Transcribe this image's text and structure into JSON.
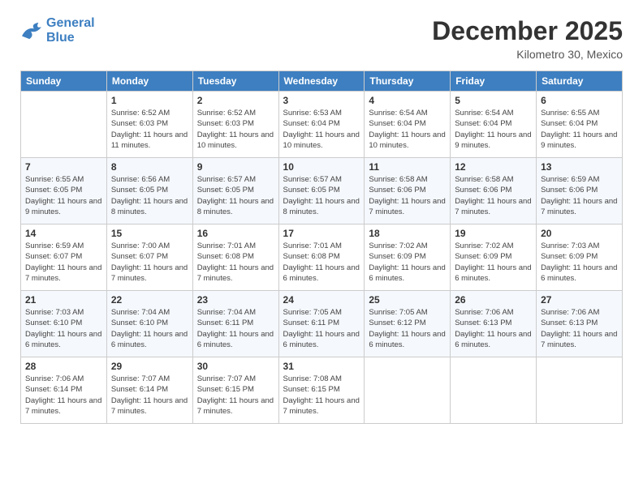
{
  "logo": {
    "line1": "General",
    "line2": "Blue"
  },
  "header": {
    "month": "December 2025",
    "location": "Kilometro 30, Mexico"
  },
  "weekdays": [
    "Sunday",
    "Monday",
    "Tuesday",
    "Wednesday",
    "Thursday",
    "Friday",
    "Saturday"
  ],
  "weeks": [
    [
      {
        "day": "",
        "sunrise": "",
        "sunset": "",
        "daylight": ""
      },
      {
        "day": "1",
        "sunrise": "Sunrise: 6:52 AM",
        "sunset": "Sunset: 6:03 PM",
        "daylight": "Daylight: 11 hours and 11 minutes."
      },
      {
        "day": "2",
        "sunrise": "Sunrise: 6:52 AM",
        "sunset": "Sunset: 6:03 PM",
        "daylight": "Daylight: 11 hours and 10 minutes."
      },
      {
        "day": "3",
        "sunrise": "Sunrise: 6:53 AM",
        "sunset": "Sunset: 6:04 PM",
        "daylight": "Daylight: 11 hours and 10 minutes."
      },
      {
        "day": "4",
        "sunrise": "Sunrise: 6:54 AM",
        "sunset": "Sunset: 6:04 PM",
        "daylight": "Daylight: 11 hours and 10 minutes."
      },
      {
        "day": "5",
        "sunrise": "Sunrise: 6:54 AM",
        "sunset": "Sunset: 6:04 PM",
        "daylight": "Daylight: 11 hours and 9 minutes."
      },
      {
        "day": "6",
        "sunrise": "Sunrise: 6:55 AM",
        "sunset": "Sunset: 6:04 PM",
        "daylight": "Daylight: 11 hours and 9 minutes."
      }
    ],
    [
      {
        "day": "7",
        "sunrise": "Sunrise: 6:55 AM",
        "sunset": "Sunset: 6:05 PM",
        "daylight": "Daylight: 11 hours and 9 minutes."
      },
      {
        "day": "8",
        "sunrise": "Sunrise: 6:56 AM",
        "sunset": "Sunset: 6:05 PM",
        "daylight": "Daylight: 11 hours and 8 minutes."
      },
      {
        "day": "9",
        "sunrise": "Sunrise: 6:57 AM",
        "sunset": "Sunset: 6:05 PM",
        "daylight": "Daylight: 11 hours and 8 minutes."
      },
      {
        "day": "10",
        "sunrise": "Sunrise: 6:57 AM",
        "sunset": "Sunset: 6:05 PM",
        "daylight": "Daylight: 11 hours and 8 minutes."
      },
      {
        "day": "11",
        "sunrise": "Sunrise: 6:58 AM",
        "sunset": "Sunset: 6:06 PM",
        "daylight": "Daylight: 11 hours and 7 minutes."
      },
      {
        "day": "12",
        "sunrise": "Sunrise: 6:58 AM",
        "sunset": "Sunset: 6:06 PM",
        "daylight": "Daylight: 11 hours and 7 minutes."
      },
      {
        "day": "13",
        "sunrise": "Sunrise: 6:59 AM",
        "sunset": "Sunset: 6:06 PM",
        "daylight": "Daylight: 11 hours and 7 minutes."
      }
    ],
    [
      {
        "day": "14",
        "sunrise": "Sunrise: 6:59 AM",
        "sunset": "Sunset: 6:07 PM",
        "daylight": "Daylight: 11 hours and 7 minutes."
      },
      {
        "day": "15",
        "sunrise": "Sunrise: 7:00 AM",
        "sunset": "Sunset: 6:07 PM",
        "daylight": "Daylight: 11 hours and 7 minutes."
      },
      {
        "day": "16",
        "sunrise": "Sunrise: 7:01 AM",
        "sunset": "Sunset: 6:08 PM",
        "daylight": "Daylight: 11 hours and 7 minutes."
      },
      {
        "day": "17",
        "sunrise": "Sunrise: 7:01 AM",
        "sunset": "Sunset: 6:08 PM",
        "daylight": "Daylight: 11 hours and 6 minutes."
      },
      {
        "day": "18",
        "sunrise": "Sunrise: 7:02 AM",
        "sunset": "Sunset: 6:09 PM",
        "daylight": "Daylight: 11 hours and 6 minutes."
      },
      {
        "day": "19",
        "sunrise": "Sunrise: 7:02 AM",
        "sunset": "Sunset: 6:09 PM",
        "daylight": "Daylight: 11 hours and 6 minutes."
      },
      {
        "day": "20",
        "sunrise": "Sunrise: 7:03 AM",
        "sunset": "Sunset: 6:09 PM",
        "daylight": "Daylight: 11 hours and 6 minutes."
      }
    ],
    [
      {
        "day": "21",
        "sunrise": "Sunrise: 7:03 AM",
        "sunset": "Sunset: 6:10 PM",
        "daylight": "Daylight: 11 hours and 6 minutes."
      },
      {
        "day": "22",
        "sunrise": "Sunrise: 7:04 AM",
        "sunset": "Sunset: 6:10 PM",
        "daylight": "Daylight: 11 hours and 6 minutes."
      },
      {
        "day": "23",
        "sunrise": "Sunrise: 7:04 AM",
        "sunset": "Sunset: 6:11 PM",
        "daylight": "Daylight: 11 hours and 6 minutes."
      },
      {
        "day": "24",
        "sunrise": "Sunrise: 7:05 AM",
        "sunset": "Sunset: 6:11 PM",
        "daylight": "Daylight: 11 hours and 6 minutes."
      },
      {
        "day": "25",
        "sunrise": "Sunrise: 7:05 AM",
        "sunset": "Sunset: 6:12 PM",
        "daylight": "Daylight: 11 hours and 6 minutes."
      },
      {
        "day": "26",
        "sunrise": "Sunrise: 7:06 AM",
        "sunset": "Sunset: 6:13 PM",
        "daylight": "Daylight: 11 hours and 6 minutes."
      },
      {
        "day": "27",
        "sunrise": "Sunrise: 7:06 AM",
        "sunset": "Sunset: 6:13 PM",
        "daylight": "Daylight: 11 hours and 7 minutes."
      }
    ],
    [
      {
        "day": "28",
        "sunrise": "Sunrise: 7:06 AM",
        "sunset": "Sunset: 6:14 PM",
        "daylight": "Daylight: 11 hours and 7 minutes."
      },
      {
        "day": "29",
        "sunrise": "Sunrise: 7:07 AM",
        "sunset": "Sunset: 6:14 PM",
        "daylight": "Daylight: 11 hours and 7 minutes."
      },
      {
        "day": "30",
        "sunrise": "Sunrise: 7:07 AM",
        "sunset": "Sunset: 6:15 PM",
        "daylight": "Daylight: 11 hours and 7 minutes."
      },
      {
        "day": "31",
        "sunrise": "Sunrise: 7:08 AM",
        "sunset": "Sunset: 6:15 PM",
        "daylight": "Daylight: 11 hours and 7 minutes."
      },
      {
        "day": "",
        "sunrise": "",
        "sunset": "",
        "daylight": ""
      },
      {
        "day": "",
        "sunrise": "",
        "sunset": "",
        "daylight": ""
      },
      {
        "day": "",
        "sunrise": "",
        "sunset": "",
        "daylight": ""
      }
    ]
  ]
}
